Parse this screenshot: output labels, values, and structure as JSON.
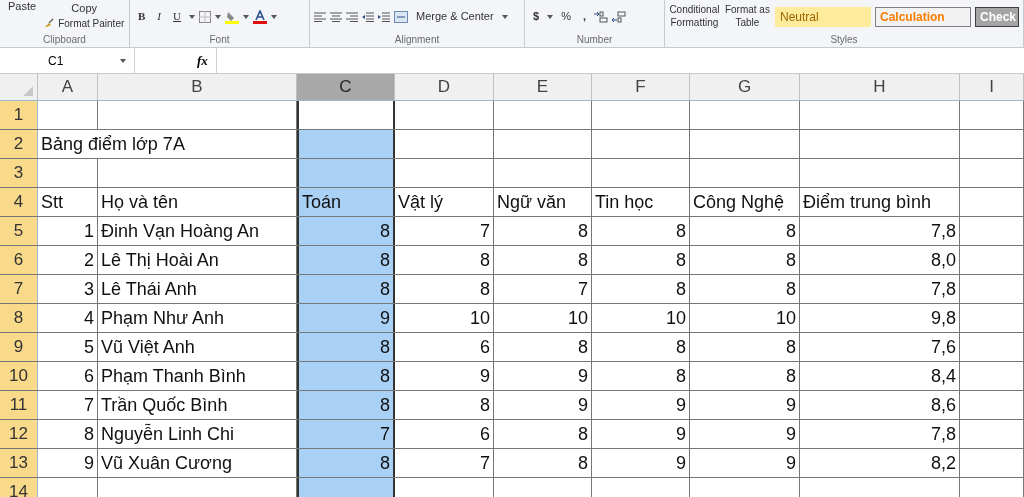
{
  "ribbon": {
    "clipboard": {
      "paste": "Paste",
      "copy": "Copy",
      "format_painter": "Format Painter",
      "label": "Clipboard"
    },
    "font": {
      "bold": "B",
      "italic": "I",
      "underline": "U",
      "label": "Font"
    },
    "alignment": {
      "merge": "Merge & Center",
      "label": "Alignment"
    },
    "number": {
      "currency": "$",
      "percent": "%",
      "comma": ",",
      "label": "Number"
    },
    "styles": {
      "conditional": "Conditional Formatting",
      "format_table": "Format as Table",
      "cells": [
        {
          "label": "Neutral",
          "kind": "neutral"
        },
        {
          "label": "Calculation",
          "kind": "calculation"
        },
        {
          "label": "Check",
          "kind": "check"
        }
      ],
      "label": "Styles"
    }
  },
  "formula_bar": {
    "name_box": "C1",
    "fx": "fx"
  },
  "columns": [
    {
      "label": "A",
      "selected": false
    },
    {
      "label": "B",
      "selected": false
    },
    {
      "label": "C",
      "selected": true
    },
    {
      "label": "D",
      "selected": false
    },
    {
      "label": "E",
      "selected": false
    },
    {
      "label": "F",
      "selected": false
    },
    {
      "label": "G",
      "selected": false
    },
    {
      "label": "H",
      "selected": false
    },
    {
      "label": "I",
      "selected": false
    }
  ],
  "rows": [
    {
      "header": "1",
      "kind": "blank"
    },
    {
      "header": "2",
      "kind": "title",
      "cells": [
        "Bảng điểm lớp 7A"
      ]
    },
    {
      "header": "3",
      "kind": "blank"
    },
    {
      "header": "4",
      "kind": "header",
      "cells": [
        "Stt",
        "Họ và tên",
        "Toán",
        "Vật lý",
        "Ngữ văn",
        "Tin học",
        "Công Nghệ",
        "Điểm trung bình"
      ]
    },
    {
      "header": "5",
      "kind": "data",
      "cells": [
        "1",
        "Đinh Vạn Hoàng An",
        "8",
        "7",
        "8",
        "8",
        "8",
        "7,8"
      ]
    },
    {
      "header": "6",
      "kind": "data",
      "cells": [
        "2",
        "Lê Thị Hoài An",
        "8",
        "8",
        "8",
        "8",
        "8",
        "8,0"
      ]
    },
    {
      "header": "7",
      "kind": "data",
      "cells": [
        "3",
        "Lê Thái Anh",
        "8",
        "8",
        "7",
        "8",
        "8",
        "7,8"
      ]
    },
    {
      "header": "8",
      "kind": "data",
      "cells": [
        "4",
        "Phạm Như Anh",
        "9",
        "10",
        "10",
        "10",
        "10",
        "9,8"
      ]
    },
    {
      "header": "9",
      "kind": "data",
      "cells": [
        "5",
        "Vũ Việt Anh",
        "8",
        "6",
        "8",
        "8",
        "8",
        "7,6"
      ]
    },
    {
      "header": "10",
      "kind": "data",
      "cells": [
        "6",
        "Phạm Thanh Bình",
        "8",
        "9",
        "9",
        "8",
        "8",
        "8,4"
      ]
    },
    {
      "header": "11",
      "kind": "data",
      "cells": [
        "7",
        "Trần Quốc Bình",
        "8",
        "8",
        "9",
        "9",
        "9",
        "8,6"
      ]
    },
    {
      "header": "12",
      "kind": "data",
      "cells": [
        "8",
        "Nguyễn Linh Chi",
        "7",
        "6",
        "8",
        "9",
        "9",
        "7,8"
      ]
    },
    {
      "header": "13",
      "kind": "data",
      "cells": [
        "9",
        "Vũ Xuân Cương",
        "8",
        "7",
        "8",
        "9",
        "9",
        "8,2"
      ]
    },
    {
      "header": "14",
      "kind": "blank"
    }
  ]
}
